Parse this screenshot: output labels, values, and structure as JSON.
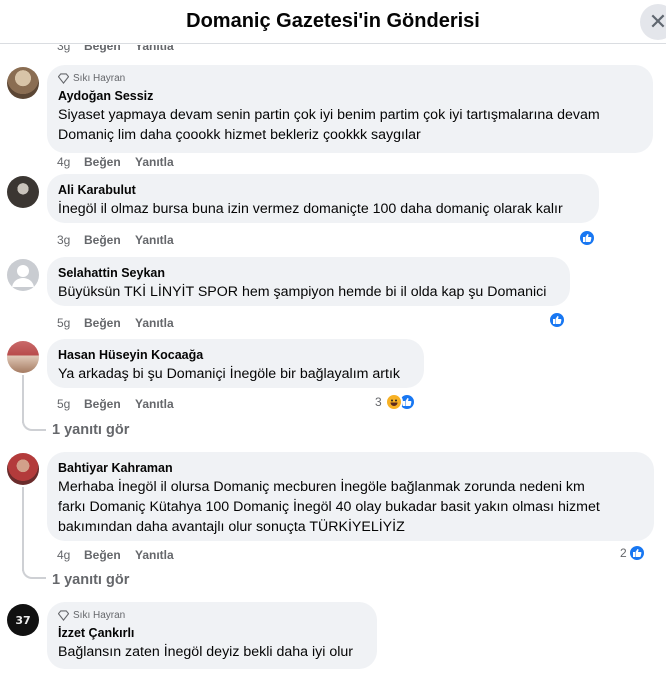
{
  "header": {
    "title": "Domaniç Gazetesi'in Gönderisi",
    "close_icon": "close-icon"
  },
  "top_actions": {
    "time": "3g",
    "like": "Beğen",
    "reply": "Yanıtla"
  },
  "comments": [
    {
      "badge": "Sıkı Hayran",
      "author": "Aydoğan Sessiz",
      "lines": [
        "Siyaset yapmaya devam senin partin çok iyi benim partim çok iyi tartışmalarına devam",
        "Domaniç lim daha çoookk hizmet bekleriz çookkk saygılar"
      ],
      "time": "4g",
      "like": "Beğen",
      "reply": "Yanıtla"
    },
    {
      "author": "Ali Karabulut",
      "lines": [
        "İnegöl il olmaz bursa buna izin vermez domaniçte 100 daha domaniç olarak kalır"
      ],
      "time": "3g",
      "like": "Beğen",
      "reply": "Yanıtla",
      "reaction": "like-icon"
    },
    {
      "author": "Selahattin Seykan",
      "lines": [
        "Büyüksün TKİ LİNYİT SPOR hem şampiyon hemde bi il olda kap şu Domanici"
      ],
      "time": "5g",
      "like": "Beğen",
      "reply": "Yanıtla",
      "reaction": "like-icon"
    },
    {
      "author": "Hasan Hüseyin Kocaağa",
      "lines": [
        "Ya arkadaş bi şu Domaniçi İnegöle bir bağlayalım artık"
      ],
      "time": "5g",
      "like": "Beğen",
      "reply": "Yanıtla",
      "reaction_count": "3",
      "view_replies": "1 yanıtı gör"
    },
    {
      "author": "Bahtiyar Kahraman",
      "lines": [
        "Merhaba İnegöl il olursa Domaniç mecburen İnegöle bağlanmak zorunda nedeni km",
        "farkı Domaniç Kütahya 100 Domaniç İnegöl 40 olay bukadar basit yakın olması hizmet",
        "bakımından daha avantajlı olur sonuçta TÜRKİYELİYİZ"
      ],
      "time": "4g",
      "like": "Beğen",
      "reply": "Yanıtla",
      "reaction_count": "2",
      "view_replies": "1 yanıtı gör"
    },
    {
      "badge": "Sıkı Hayran",
      "author": "İzzet Çankırlı",
      "lines": [
        "Bağlansın zaten İnegöl deyiz bekli daha iyi olur"
      ],
      "avatar_text": "37"
    }
  ],
  "colors": {
    "accent": "#1877f2",
    "bubble": "#f0f2f5",
    "muted": "#65676b"
  }
}
